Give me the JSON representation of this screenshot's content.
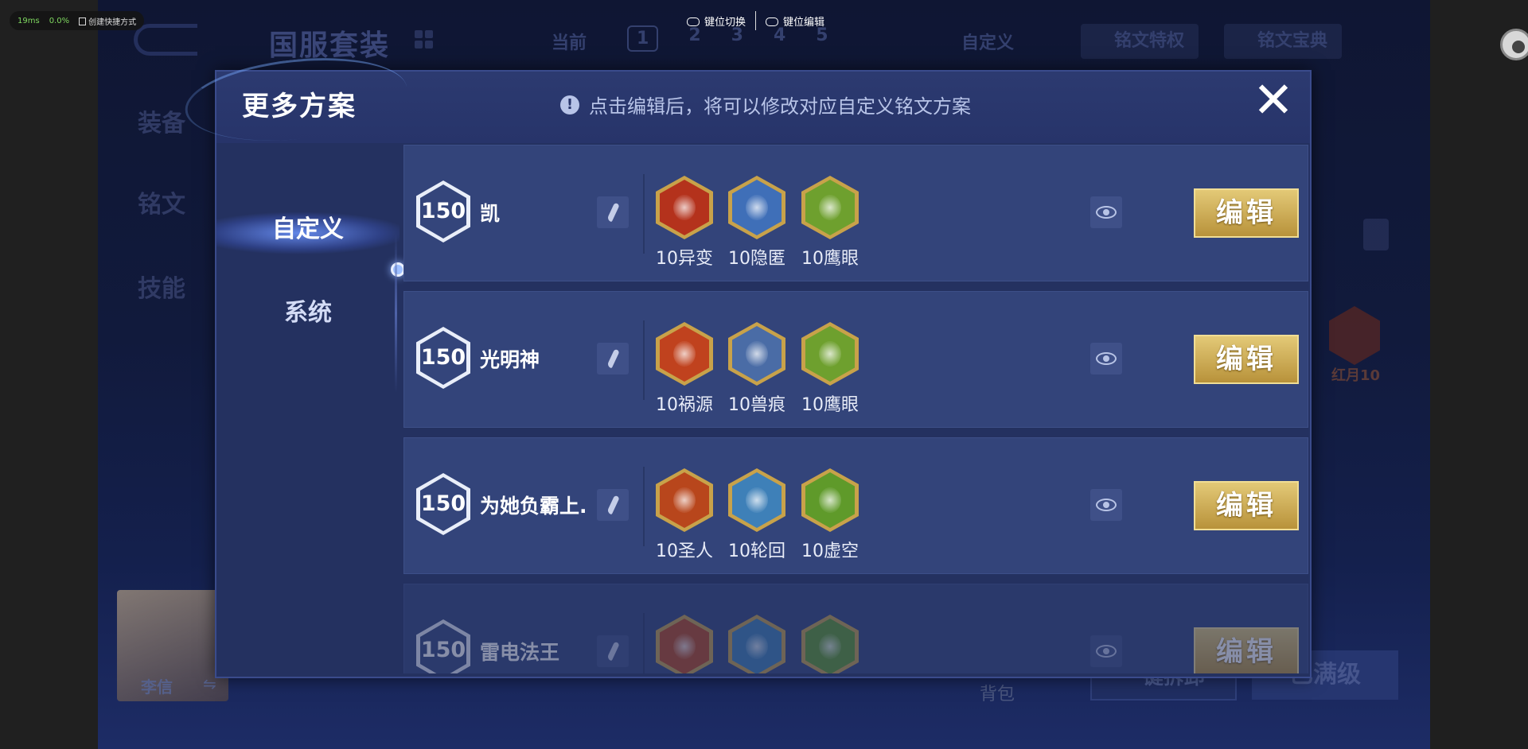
{
  "overlay": {
    "latency": "19ms",
    "cpu": "0.0%",
    "shortcut": "创建快捷方式"
  },
  "keybar": {
    "switch_label": "键位切换",
    "edit_label": "键位编辑"
  },
  "background": {
    "title": "国服套装",
    "current_label": "当前",
    "pages": [
      "1",
      "2",
      "3",
      "4",
      "5"
    ],
    "custom_label": "自定义",
    "tab_privilege": "铭文特权",
    "tab_codex": "铭文宝典",
    "side_tabs": [
      "装备",
      "铭文",
      "技能"
    ],
    "rune_label": "红月10",
    "hero_name": "李信",
    "swap_icon": "⇋",
    "bag_label": "背包",
    "btn_quick": "一键拆卸",
    "btn_maxlevel": "已满级"
  },
  "modal": {
    "title": "更多方案",
    "hint": "点击编辑后，将可以修改对应自定义铭文方案",
    "hint_icon": "!",
    "close_icon": "✕",
    "sidebar": [
      {
        "label": "自定义",
        "active": true
      },
      {
        "label": "系统",
        "active": false
      }
    ],
    "plans": [
      {
        "level": "150",
        "name": "凯",
        "runes": [
          {
            "label": "10异变",
            "color": "#b4321c"
          },
          {
            "label": "10隐匿",
            "color": "#3f6fb8"
          },
          {
            "label": "10鹰眼",
            "color": "#6ea02e"
          }
        ],
        "edit_label": "编辑"
      },
      {
        "level": "150",
        "name": "光明神",
        "runes": [
          {
            "label": "10祸源",
            "color": "#c0421e"
          },
          {
            "label": "10兽痕",
            "color": "#4a6ca6"
          },
          {
            "label": "10鹰眼",
            "color": "#6ea02e"
          }
        ],
        "edit_label": "编辑"
      },
      {
        "level": "150",
        "name": "为她负霸上.",
        "runes": [
          {
            "label": "10圣人",
            "color": "#b8461c"
          },
          {
            "label": "10轮回",
            "color": "#3e80b8"
          },
          {
            "label": "10虚空",
            "color": "#5f9a2a"
          }
        ],
        "edit_label": "编辑"
      },
      {
        "level": "150",
        "name": "雷电法王",
        "runes": [
          {
            "label": "",
            "color": "#b8461c"
          },
          {
            "label": "",
            "color": "#3e80b8"
          },
          {
            "label": "",
            "color": "#5f9a2a"
          }
        ],
        "edit_label": "编辑"
      }
    ]
  },
  "colors": {
    "modal_bg": "#243160",
    "row_bg": "#33447a",
    "gold": "#d4b35a"
  }
}
